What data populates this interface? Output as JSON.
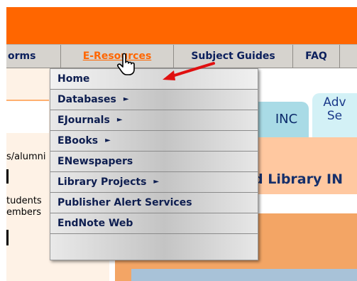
{
  "nav": {
    "items": [
      {
        "label": "orms"
      },
      {
        "label": "E-Resources"
      },
      {
        "label": "Subject Guides"
      },
      {
        "label": "FAQ"
      }
    ],
    "active": "E-Resources"
  },
  "side": {
    "alumni_text": "s/alumni",
    "students_text": "tudents",
    "members_text": "embers"
  },
  "tabs": {
    "inc": "INC",
    "adv_line1": "Adv",
    "adv_line2": "Se"
  },
  "heading": {
    "library_text": "d Library IN"
  },
  "dropdown": {
    "items": [
      {
        "label": "Home",
        "arrow": ""
      },
      {
        "label": "Databases",
        "arrow": "►"
      },
      {
        "label": "EJournals",
        "arrow": "►"
      },
      {
        "label": "EBooks",
        "arrow": "►"
      },
      {
        "label": "ENewspapers",
        "arrow": ""
      },
      {
        "label": "Library Projects",
        "arrow": "►"
      },
      {
        "label": "Publisher Alert Services",
        "arrow": ""
      },
      {
        "label": "EndNote Web",
        "arrow": ""
      }
    ]
  },
  "icons": {
    "cursor": "hand-pointer-icon",
    "annotation": "red-arrow-icon"
  },
  "colors": {
    "header_orange": "#ff6600",
    "nav_grey": "#d6d3ce",
    "nav_text": "#0b1f5c",
    "arrow_red": "#e01010"
  }
}
